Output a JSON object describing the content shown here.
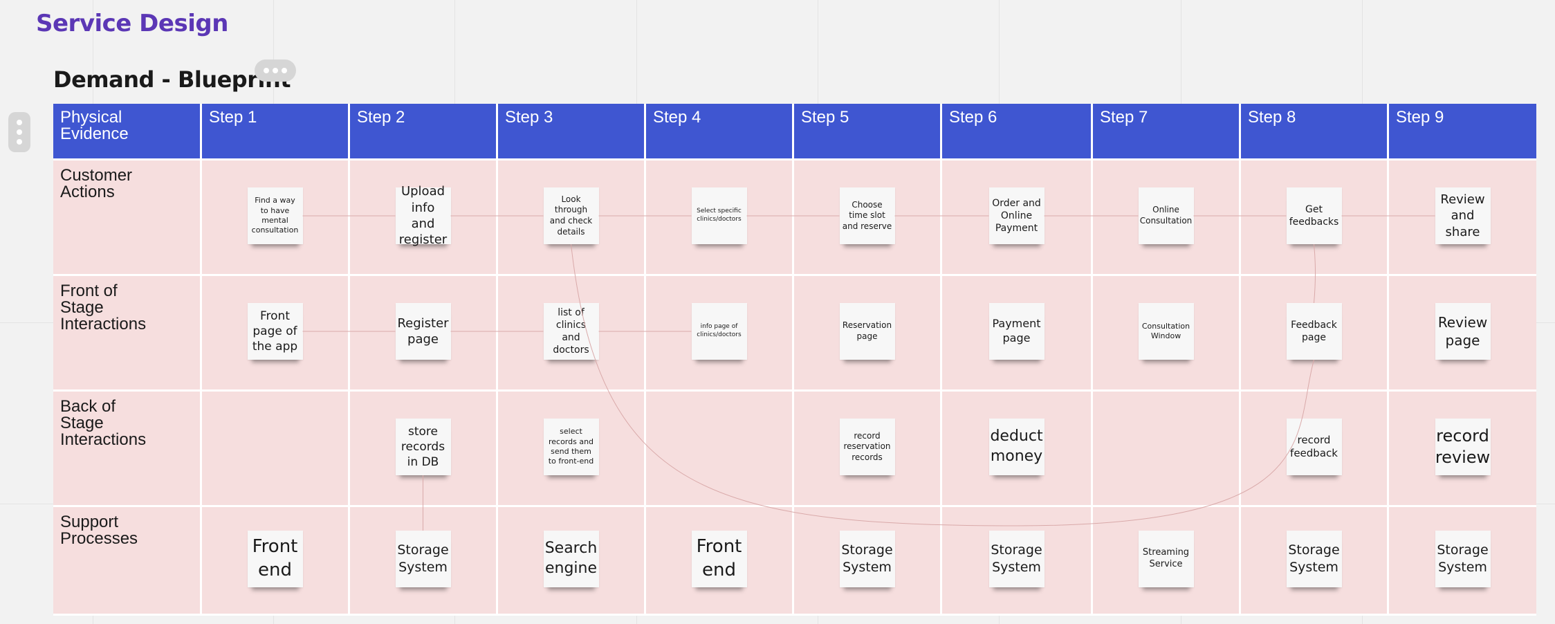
{
  "board_title": "Service Design",
  "frame_title": "Demand - Blueprint",
  "header": {
    "corner": "Physical\nEvidence",
    "steps": [
      "Step 1",
      "Step 2",
      "Step 3",
      "Step 4",
      "Step 5",
      "Step 6",
      "Step 7",
      "Step 8",
      "Step 9"
    ]
  },
  "rows": [
    {
      "label": "Customer\nActions",
      "notes": [
        "Find a way to have mental consultation",
        "Upload info and register",
        "Look through and check details",
        "Select specific clinics/doctors",
        "Choose time slot and reserve",
        "Order and Online Payment",
        "Online Consultation",
        "Get feedbacks",
        "Review and share"
      ]
    },
    {
      "label": "Front of\nStage Interactions",
      "notes": [
        "Front page of the app",
        "Register page",
        "list of clinics and doctors",
        "info page of clinics/doctors",
        "Reservation page",
        "Payment page",
        "Consultation Window",
        "Feedback page",
        "Review page"
      ]
    },
    {
      "label": "Back of\nStage Interactions",
      "notes": [
        "",
        "store records in DB",
        "select records and send them to front-end",
        "",
        "record reservation records",
        "deduct money",
        "",
        "record feedback",
        "record review"
      ]
    },
    {
      "label": "Support\nProcesses",
      "notes": [
        "Front end",
        "Storage System",
        "Search engine",
        "Front end",
        "Storage System",
        "Storage System",
        "Streaming Service",
        "Storage System",
        "Storage System"
      ]
    }
  ],
  "colors": {
    "header": "#3f56d1",
    "row": "#f6dede",
    "title": "#5b37b5"
  },
  "icons": {
    "more": "more-horizontal-icon",
    "handle": "drag-handle-icon"
  }
}
